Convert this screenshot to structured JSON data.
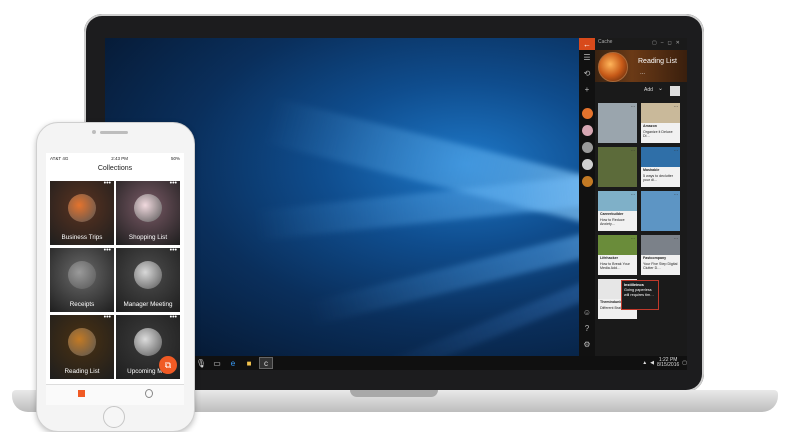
{
  "laptop": {
    "taskbar_search_label": "c",
    "clock_time": "1:22 PM",
    "clock_date": "8/15/2016"
  },
  "cache_app": {
    "window_title": "Cache",
    "back_glyph": "←",
    "collection_title": "Reading List",
    "more_glyph": "...",
    "add_label": "Add",
    "cards": [
      {
        "title": "",
        "text": "",
        "img": "#9aa5ad"
      },
      {
        "title": "Amazon",
        "text": "Organize it Deluxe Di…",
        "img": "#c9b99a"
      },
      {
        "title": "",
        "text": "",
        "img": "#5c6b3a"
      },
      {
        "title": "Mashable",
        "text": "5 ways to declutter your di…",
        "img": "#2f6fa8"
      },
      {
        "title": "Careerbuilder",
        "text": "How to Reduce Anxiety…",
        "img": "#7fb0c8"
      },
      {
        "title": "",
        "text": "",
        "img": "#5d95c4"
      },
      {
        "title": "Lifehacker",
        "text": "How to Break Your Media Add…",
        "img": "#6a8c3a"
      },
      {
        "title": "Fastcompany",
        "text": "Your Five Step Digital Clutter D…",
        "img": "#7b8189"
      },
      {
        "title": "Themindunleashed",
        "text": "Different Brains…",
        "img": "#e6e6e6"
      }
    ],
    "tooltip_title": "Instilleinos",
    "tooltip_text": "Going paperless will requires tim…"
  },
  "phone": {
    "carrier": "AT&T 4G",
    "time": "2:43 PM",
    "battery": "50%",
    "title": "Collections",
    "tiles": [
      {
        "label": "Business Trips",
        "bg": "#5b3320",
        "circle": "#e4732d"
      },
      {
        "label": "Shopping List",
        "bg": "#7a5a66",
        "circle": "#f1d9de"
      },
      {
        "label": "Receipts",
        "bg": "#6a6a6a",
        "circle": "#9a9a9a"
      },
      {
        "label": "Manager Meeting",
        "bg": "#4d4d4d",
        "circle": "#d8d8d8"
      },
      {
        "label": "Reading List",
        "bg": "#4a3112",
        "circle": "#c37a24"
      },
      {
        "label": "Upcoming M…",
        "bg": "#3b3b3b",
        "circle": "#dcdcdc"
      }
    ],
    "more_glyph": "•••"
  },
  "colors": {
    "accent": "#f05a24",
    "app_accent": "#d84a1b",
    "app_bg": "#1a1a1a"
  }
}
